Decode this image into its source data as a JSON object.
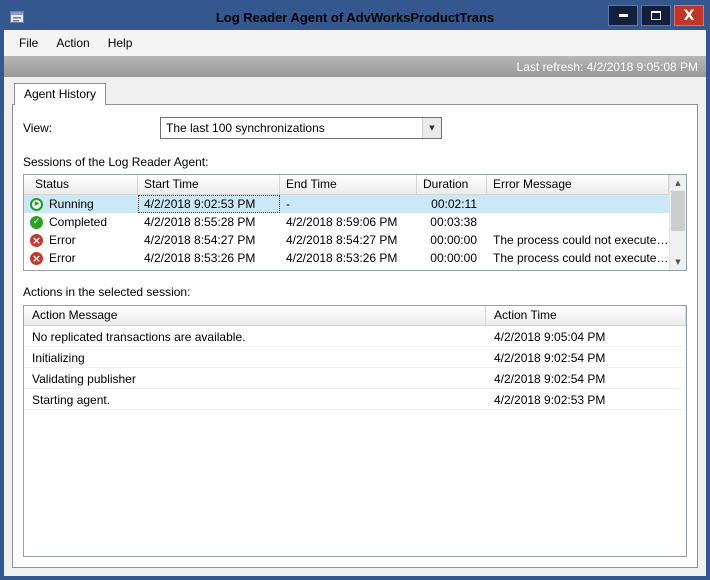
{
  "window": {
    "title": "Log Reader Agent of AdvWorksProductTrans"
  },
  "menu": {
    "items": [
      "File",
      "Action",
      "Help"
    ]
  },
  "refresh_bar": {
    "last_refresh": "Last refresh: 4/2/2018 9:05:08 PM"
  },
  "tabs": {
    "agent_history": "Agent History"
  },
  "view": {
    "label": "View:",
    "selected": "The last 100 synchronizations"
  },
  "sessions": {
    "caption": "Sessions of the Log Reader Agent:",
    "columns": [
      "Status",
      "Start Time",
      "End Time",
      "Duration",
      "Error Message"
    ],
    "rows": [
      {
        "icon": "running-icon",
        "status": "Running",
        "start_time": "4/2/2018 9:02:53 PM",
        "end_time": "-",
        "duration": "00:02:11",
        "error_message": "",
        "selected": true
      },
      {
        "icon": "completed-icon",
        "status": "Completed",
        "start_time": "4/2/2018 8:55:28 PM",
        "end_time": "4/2/2018 8:59:06 PM",
        "duration": "00:03:38",
        "error_message": "",
        "selected": false
      },
      {
        "icon": "error-icon",
        "status": "Error",
        "start_time": "4/2/2018 8:54:27 PM",
        "end_time": "4/2/2018 8:54:27 PM",
        "duration": "00:00:00",
        "error_message": "The process could not execute '...",
        "selected": false
      },
      {
        "icon": "error-icon",
        "status": "Error",
        "start_time": "4/2/2018 8:53:26 PM",
        "end_time": "4/2/2018 8:53:26 PM",
        "duration": "00:00:00",
        "error_message": "The process could not execute '...",
        "selected": false
      }
    ]
  },
  "actions": {
    "caption": "Actions in the selected session:",
    "columns": [
      "Action Message",
      "Action Time"
    ],
    "rows": [
      {
        "message": "No replicated transactions are available.",
        "time": "4/2/2018 9:05:04 PM"
      },
      {
        "message": "Initializing",
        "time": "4/2/2018 9:02:54 PM"
      },
      {
        "message": "Validating publisher",
        "time": "4/2/2018 9:02:54 PM"
      },
      {
        "message": "Starting agent.",
        "time": "4/2/2018 9:02:53 PM"
      }
    ]
  },
  "colors": {
    "frame_blue": "#35578f",
    "selection_blue": "#cbe8f6",
    "running_green": "#1f9c1f",
    "completed_green": "#27a227",
    "error_red": "#c8372d",
    "close_button_red": "#c0372a"
  }
}
